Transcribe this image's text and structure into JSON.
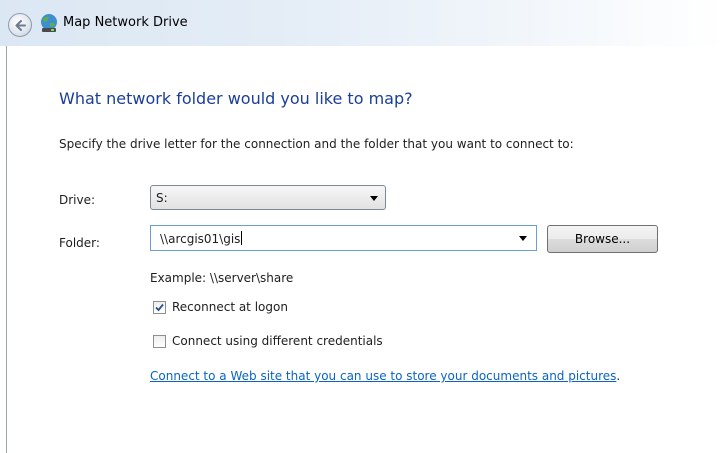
{
  "window": {
    "title": "Map Network Drive"
  },
  "icons": {
    "back": "back-arrow-icon",
    "app": "network-drive-icon",
    "dropdown": "chevron-down-icon",
    "checkmark": "checkmark-icon"
  },
  "colors": {
    "heading": "#1a3e9a",
    "link": "#0a63c6",
    "titlebar": "#dbe7f3"
  },
  "main": {
    "heading": "What network folder would you like to map?",
    "description": "Specify the drive letter for the connection and the folder that you want to connect to:",
    "drive": {
      "label": "Drive:",
      "value": "S:"
    },
    "folder": {
      "label": "Folder:",
      "value": "\\\\arcgis01\\gis",
      "browse_label": "Browse..."
    },
    "example": "Example: \\\\server\\share",
    "reconnect": {
      "label": "Reconnect at logon",
      "checked": true
    },
    "credentials": {
      "label": "Connect using different credentials",
      "checked": false
    },
    "web_link": "Connect to a Web site that you can use to store your documents and pictures",
    "link_suffix": "."
  }
}
